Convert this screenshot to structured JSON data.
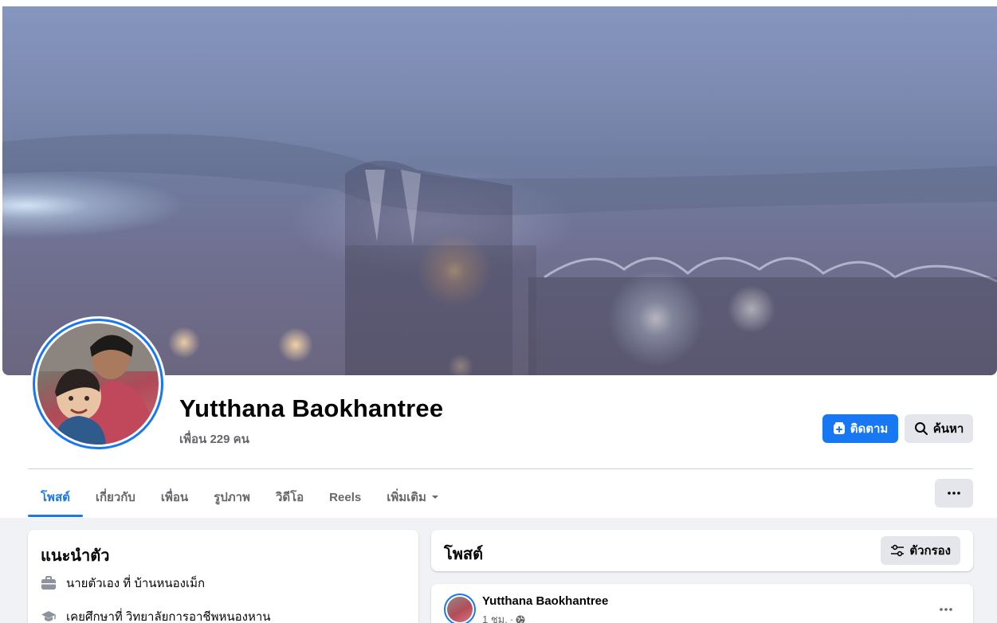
{
  "profile": {
    "name": "Yutthana Baokhantree",
    "friends": "เพื่อน 229 คน"
  },
  "actions": {
    "follow_label": "ติดตาม",
    "search_label": "ค้นหา"
  },
  "tabs": [
    {
      "label": "โพสต์",
      "active": true
    },
    {
      "label": "เกี่ยวกับ",
      "active": false
    },
    {
      "label": "เพื่อน",
      "active": false
    },
    {
      "label": "รูปภาพ",
      "active": false
    },
    {
      "label": "วิดีโอ",
      "active": false
    },
    {
      "label": "Reels",
      "active": false
    },
    {
      "label": "เพิ่มเติม",
      "active": false
    }
  ],
  "intro": {
    "title": "แนะนำตัว",
    "items": [
      {
        "icon": "briefcase-icon",
        "text": "นายตัวเอง ที่ บ้านหนองเม็ก"
      },
      {
        "icon": "graduation-cap-icon",
        "text": "เคยศึกษาที่ วิทยาลัยการอาชีพหนองหาน"
      }
    ]
  },
  "posts": {
    "title": "โพสต์",
    "filter_label": "ตัวกรอง",
    "first_post": {
      "author": "Yutthana Baokhantree",
      "time": "1 ชม.",
      "audience_icon": "globe-icon"
    }
  },
  "colors": {
    "accent": "#1877f2",
    "button_gray": "#e4e6eb",
    "page_background": "#f0f2f5",
    "secondary_text": "#65676b"
  }
}
